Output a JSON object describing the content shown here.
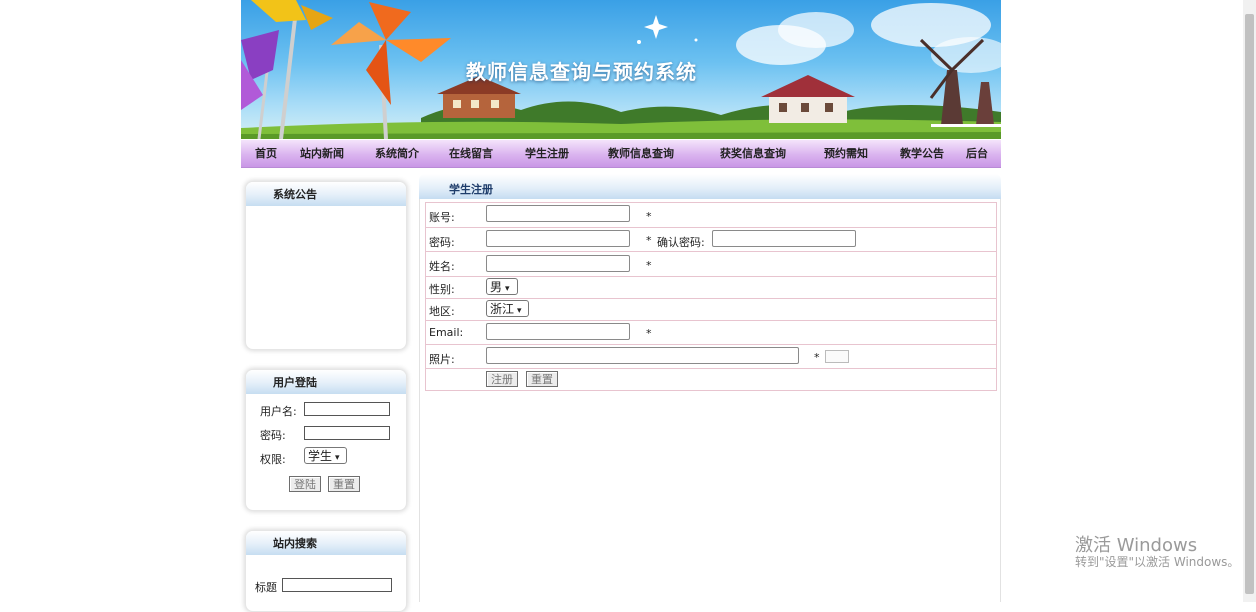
{
  "banner": {
    "title": "教师信息查询与预约系统"
  },
  "nav": {
    "items": [
      {
        "label": "首页"
      },
      {
        "label": "站内新闻"
      },
      {
        "label": "系统简介"
      },
      {
        "label": "在线留言"
      },
      {
        "label": "学生注册"
      },
      {
        "label": "教师信息查询"
      },
      {
        "label": "获奖信息查询"
      },
      {
        "label": "预约需知"
      },
      {
        "label": "教学公告"
      },
      {
        "label": "后台"
      }
    ]
  },
  "sidebar": {
    "announcement": {
      "title": "系统公告"
    },
    "login": {
      "title": "用户登陆",
      "username_label": "用户名:",
      "password_label": "密码:",
      "role_label": "权限:",
      "role_selected": "学生",
      "login_button": "登陆",
      "reset_button": "重置"
    },
    "search": {
      "title": "站内搜索",
      "title_label": "标题"
    }
  },
  "main": {
    "title": "学生注册",
    "form": {
      "account_label": "账号:",
      "password_label": "密码:",
      "confirm_label": "确认密码:",
      "name_label": "姓名:",
      "gender_label": "性别:",
      "gender_selected": "男",
      "region_label": "地区:",
      "region_selected": "浙江",
      "email_label": "Email:",
      "photo_label": "照片:",
      "required_mark": "*",
      "submit_button": "注册",
      "reset_button": "重置"
    }
  },
  "watermark": {
    "line1": "激活 Windows",
    "line2": "转到\"设置\"以激活 Windows。"
  }
}
